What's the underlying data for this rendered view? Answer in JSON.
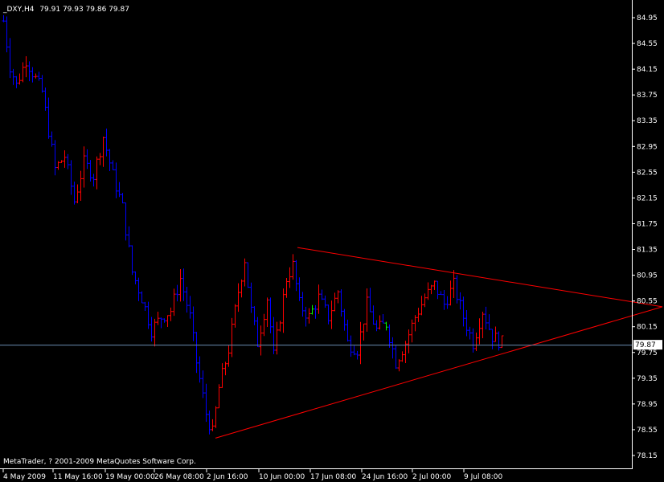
{
  "header": {
    "symbol_timeframe": "_DXY,H4",
    "ohlc": "79.91 79.93 79.86 79.87"
  },
  "footer": {
    "copyright": "MetaTrader, ? 2001-2009 MetaQuotes Software Corp."
  },
  "colors": {
    "background": "#000000",
    "bar_up": "#ff0000",
    "bar_down": "#0000ff",
    "bar_highlight": "#00ff00",
    "trendline": "#ff0000",
    "price_line": "#6a8ab0",
    "axis": "#ffffff"
  },
  "chart_data": {
    "type": "bar",
    "title": "",
    "xlabel": "",
    "ylabel": "",
    "ylim": [
      78.05,
      85.1
    ],
    "y_ticks": [
      "84.95",
      "84.55",
      "84.15",
      "83.75",
      "83.35",
      "82.95",
      "82.55",
      "82.15",
      "81.75",
      "81.35",
      "80.95",
      "80.55",
      "80.15",
      "79.75",
      "79.35",
      "78.95",
      "78.55",
      "78.15"
    ],
    "x_ticks": [
      "4 May 2009",
      "11 May 16:00",
      "19 May 00:00",
      "26 May 08:00",
      "2 Jun 16:00",
      "10 Jun 00:00",
      "17 Jun 08:00",
      "24 Jun 16:00",
      "2 Jul 00:00",
      "9 Jul 08:00"
    ],
    "current_price": "79.87",
    "price_anchors": [
      [
        0,
        84.9
      ],
      [
        2,
        84.2
      ],
      [
        4,
        83.9
      ],
      [
        7,
        84.3
      ],
      [
        10,
        84.0
      ],
      [
        12,
        83.8
      ],
      [
        16,
        82.6
      ],
      [
        19,
        82.8
      ],
      [
        22,
        82.1
      ],
      [
        25,
        82.7
      ],
      [
        28,
        82.5
      ],
      [
        31,
        83.1
      ],
      [
        34,
        82.5
      ],
      [
        37,
        82.0
      ],
      [
        40,
        81.0
      ],
      [
        43,
        80.6
      ],
      [
        46,
        80.1
      ],
      [
        49,
        80.3
      ],
      [
        52,
        80.4
      ],
      [
        55,
        80.9
      ],
      [
        58,
        80.3
      ],
      [
        60,
        79.6
      ],
      [
        63,
        78.8
      ],
      [
        65,
        78.5
      ],
      [
        67,
        79.2
      ],
      [
        70,
        79.8
      ],
      [
        73,
        80.7
      ],
      [
        75,
        81.2
      ],
      [
        77,
        80.4
      ],
      [
        79,
        79.9
      ],
      [
        82,
        80.6
      ],
      [
        84,
        79.7
      ],
      [
        86,
        80.3
      ],
      [
        88,
        80.9
      ],
      [
        90,
        81.1
      ],
      [
        92,
        80.5
      ],
      [
        95,
        80.3
      ],
      [
        98,
        80.6
      ],
      [
        101,
        80.3
      ],
      [
        104,
        80.7
      ],
      [
        107,
        79.9
      ],
      [
        110,
        79.8
      ],
      [
        113,
        80.5
      ],
      [
        116,
        80.1
      ],
      [
        119,
        80.2
      ],
      [
        122,
        79.6
      ],
      [
        125,
        79.9
      ],
      [
        128,
        80.3
      ],
      [
        131,
        80.6
      ],
      [
        134,
        80.8
      ],
      [
        137,
        80.5
      ],
      [
        140,
        80.8
      ],
      [
        143,
        80.3
      ],
      [
        146,
        79.9
      ],
      [
        149,
        80.4
      ],
      [
        152,
        80.0
      ],
      [
        155,
        79.9
      ]
    ],
    "trendlines": [
      {
        "from": [
          65,
          78.42
        ],
        "to": [
          236,
          80.46
        ]
      },
      {
        "from": [
          90,
          81.38
        ],
        "to": [
          236,
          80.46
        ]
      }
    ]
  }
}
